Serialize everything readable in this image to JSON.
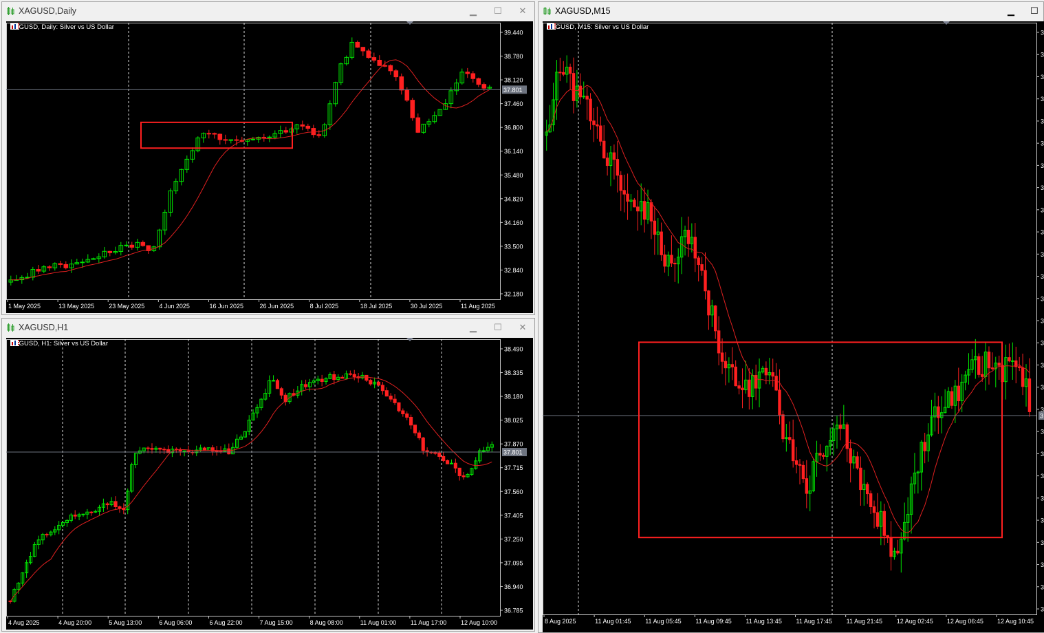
{
  "colors": {
    "bull": "#00e600",
    "bear": "#ff2020",
    "ma": "#e02020",
    "grid": "#ffffff",
    "box": "#ff2020",
    "bid": "#6e7480",
    "background": "#000000"
  },
  "windows": {
    "daily": {
      "title": "XAGUSD,Daily",
      "symbol_label": "XAGUSD, Daily:  Silver vs US Dollar",
      "price_tag": "37.801",
      "chart_data": {
        "type": "candlestick",
        "y_ticks": [
          "39.440",
          "38.780",
          "38.120",
          "37.460",
          "36.800",
          "36.140",
          "35.480",
          "34.820",
          "34.160",
          "33.500",
          "32.840",
          "32.180"
        ],
        "ylim": [
          31.7,
          39.75
        ],
        "x_ticks": [
          "1 May 2025",
          "13 May 2025",
          "23 May 2025",
          "4 Jun 2025",
          "16 Jun 2025",
          "26 Jun 2025",
          "8 Jul 2025",
          "18 Jul 2025",
          "30 Jul 2025",
          "11 Aug 2025"
        ],
        "bid": 37.801,
        "box": {
          "from": 36.1,
          "to": 36.85
        },
        "n": 88,
        "anchors": [
          [
            0,
            32.2
          ],
          [
            8,
            32.6
          ],
          [
            15,
            32.7
          ],
          [
            20,
            32.9
          ],
          [
            27,
            33.2
          ],
          [
            32,
            33.3
          ],
          [
            35,
            33.0
          ],
          [
            40,
            34.8
          ],
          [
            44,
            35.8
          ],
          [
            48,
            36.5
          ],
          [
            55,
            36.3
          ],
          [
            62,
            36.4
          ],
          [
            66,
            36.5
          ],
          [
            72,
            36.7
          ],
          [
            78,
            36.5
          ],
          [
            82,
            38.3
          ],
          [
            86,
            39.2
          ],
          [
            90,
            38.6
          ],
          [
            96,
            38.4
          ],
          [
            102,
            36.6
          ],
          [
            108,
            37.2
          ],
          [
            113,
            38.3
          ],
          [
            120,
            37.8
          ]
        ]
      }
    },
    "h1": {
      "title": "XAGUSD,H1",
      "symbol_label": "XAGUSD, H1:  Silver vs US Dollar",
      "price_tag": "37.801",
      "chart_data": {
        "type": "candlestick",
        "y_ticks": [
          "38.490",
          "38.335",
          "38.180",
          "38.025",
          "37.870",
          "37.715",
          "37.560",
          "37.405",
          "37.250",
          "37.095",
          "36.940",
          "36.785"
        ],
        "ylim": [
          36.7,
          38.56
        ],
        "x_ticks": [
          "4 Aug 2025",
          "4 Aug 20:00",
          "5 Aug 13:00",
          "6 Aug 06:00",
          "6 Aug 22:00",
          "7 Aug 15:00",
          "8 Aug 08:00",
          "11 Aug 01:00",
          "11 Aug 17:00",
          "12 Aug 10:00"
        ],
        "bid": 37.801,
        "n": 120,
        "anchors": [
          [
            0,
            36.8
          ],
          [
            8,
            37.2
          ],
          [
            16,
            37.35
          ],
          [
            24,
            37.4
          ],
          [
            30,
            37.45
          ],
          [
            34,
            37.4
          ],
          [
            37,
            37.8
          ],
          [
            44,
            37.82
          ],
          [
            52,
            37.8
          ],
          [
            60,
            37.82
          ],
          [
            66,
            37.8
          ],
          [
            70,
            37.95
          ],
          [
            74,
            38.1
          ],
          [
            78,
            38.3
          ],
          [
            82,
            38.15
          ],
          [
            88,
            38.25
          ],
          [
            94,
            38.3
          ],
          [
            100,
            38.32
          ],
          [
            106,
            38.3
          ],
          [
            112,
            38.2
          ],
          [
            118,
            38.05
          ],
          [
            124,
            37.8
          ],
          [
            130,
            37.75
          ],
          [
            136,
            37.62
          ],
          [
            140,
            37.8
          ],
          [
            144,
            37.85
          ]
        ]
      }
    },
    "m15": {
      "title": "XAGUSD,M15",
      "symbol_label": "XAGUSD, M15:  Silver vs US Dollar",
      "price_tag": "3",
      "chart_data": {
        "type": "candlestick",
        "y_ticks": [
          "3",
          "3",
          "3",
          "3",
          "3",
          "3",
          "3",
          "3",
          "3",
          "3",
          "3",
          "3",
          "3",
          "3",
          "3",
          "3",
          "3",
          "3",
          "3",
          "3",
          "3",
          "3",
          "3",
          "3",
          "3",
          "3",
          "3"
        ],
        "ylim": [
          0,
          100
        ],
        "x_ticks": [
          "8 Aug 2025",
          "11 Aug 01:45",
          "11 Aug 05:45",
          "11 Aug 09:45",
          "11 Aug 13:45",
          "11 Aug 17:45",
          "11 Aug 21:45",
          "12 Aug 02:45",
          "12 Aug 06:45",
          "12 Aug 10:45"
        ],
        "bid": 33.6,
        "box": {
          "from": 13.0,
          "to": 46.0
        },
        "n": 144,
        "anchors": [
          [
            0,
            81
          ],
          [
            4,
            90
          ],
          [
            8,
            91
          ],
          [
            12,
            88
          ],
          [
            16,
            85
          ],
          [
            20,
            82
          ],
          [
            26,
            76
          ],
          [
            32,
            72
          ],
          [
            40,
            68
          ],
          [
            46,
            62
          ],
          [
            50,
            58
          ],
          [
            54,
            64
          ],
          [
            58,
            62
          ],
          [
            62,
            56
          ],
          [
            66,
            50
          ],
          [
            70,
            44
          ],
          [
            74,
            40
          ],
          [
            80,
            38
          ],
          [
            86,
            42
          ],
          [
            90,
            40
          ],
          [
            94,
            30
          ],
          [
            98,
            27
          ],
          [
            104,
            22
          ],
          [
            108,
            26
          ],
          [
            112,
            30
          ],
          [
            116,
            33
          ],
          [
            122,
            25
          ],
          [
            128,
            20
          ],
          [
            134,
            15
          ],
          [
            138,
            10
          ],
          [
            142,
            14
          ],
          [
            146,
            22
          ],
          [
            152,
            32
          ],
          [
            158,
            35
          ],
          [
            164,
            37
          ],
          [
            168,
            41
          ],
          [
            172,
            42
          ],
          [
            176,
            43
          ],
          [
            180,
            40
          ],
          [
            184,
            42
          ],
          [
            188,
            41
          ],
          [
            192,
            36
          ]
        ]
      }
    }
  }
}
